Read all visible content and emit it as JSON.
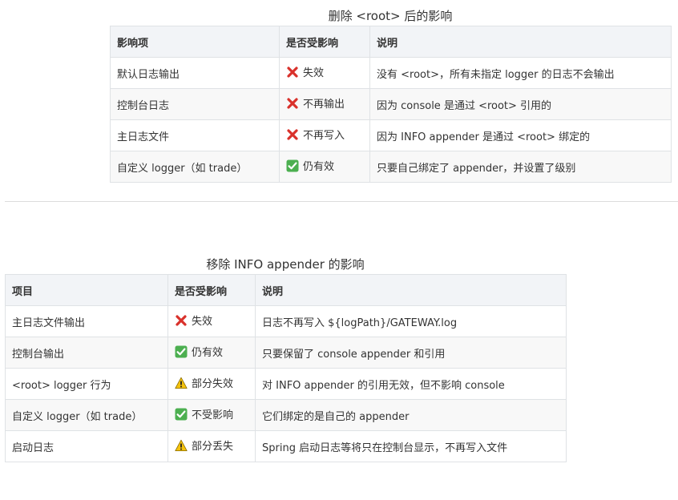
{
  "table1": {
    "caption": "删除 <root> 后的影响",
    "headers": [
      "影响项",
      "是否受影响",
      "说明"
    ],
    "rows": [
      {
        "item": "默认日志输出",
        "status_icon": "cross-mark-icon",
        "status": "失效",
        "desc": "没有 <root>，所有未指定 logger 的日志不会输出"
      },
      {
        "item": "控制台日志",
        "status_icon": "cross-mark-icon",
        "status": "不再输出",
        "desc": "因为 console 是通过 <root> 引用的"
      },
      {
        "item": "主日志文件",
        "status_icon": "cross-mark-icon",
        "status": "不再写入",
        "desc": "因为 INFO appender 是通过 <root> 绑定的"
      },
      {
        "item": "自定义 logger（如 trade）",
        "status_icon": "check-mark-icon",
        "status": "仍有效",
        "desc": "只要自己绑定了 appender，并设置了级别"
      }
    ]
  },
  "table2": {
    "caption": "移除 INFO appender 的影响",
    "headers": [
      "项目",
      "是否受影响",
      "说明"
    ],
    "rows": [
      {
        "item": "主日志文件输出",
        "status_icon": "cross-mark-icon",
        "status": "失效",
        "desc": "日志不再写入 ${logPath}/GATEWAY.log"
      },
      {
        "item": "控制台输出",
        "status_icon": "check-mark-icon",
        "status": "仍有效",
        "desc": "只要保留了 console appender 和引用"
      },
      {
        "item": "<root> logger 行为",
        "status_icon": "warning-icon",
        "status": "部分失效",
        "desc": "对 INFO appender 的引用无效，但不影响 console"
      },
      {
        "item": "自定义 logger（如 trade）",
        "status_icon": "check-mark-icon",
        "status": "不受影响",
        "desc": "它们绑定的是自己的 appender"
      },
      {
        "item": "启动日志",
        "status_icon": "warning-icon",
        "status": "部分丢失",
        "desc": "Spring 启动日志等将只在控制台显示，不再写入文件"
      }
    ]
  },
  "colors": {
    "cross": "#d9312b",
    "check_bg": "#4caf50",
    "warning": "#f4c20d",
    "header_bg": "#f2f4f7",
    "border": "#dfe2e5"
  }
}
